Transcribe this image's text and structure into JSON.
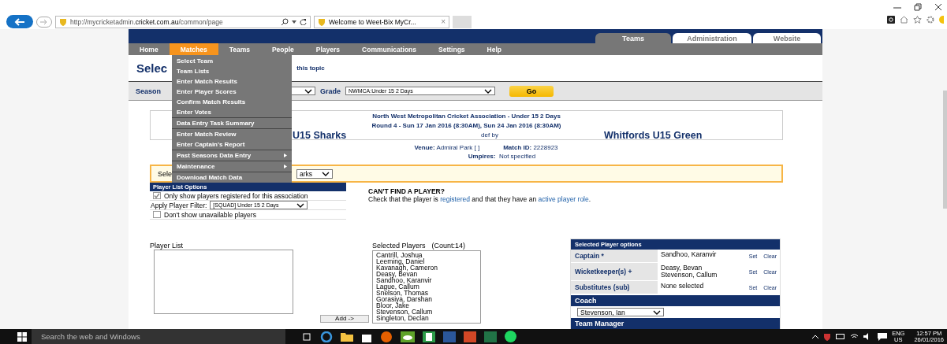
{
  "browser": {
    "address_host": "http://mycricketadmin.",
    "address_domain": "cricket.com.au",
    "address_path": "/common/page",
    "tab_title": "Welcome to Weet-Bix MyCr...",
    "tab_close": "×"
  },
  "header_tabs": [
    {
      "label": "Teams",
      "selected": true
    },
    {
      "label": "Administration",
      "selected": false
    },
    {
      "label": "Website",
      "selected": false
    }
  ],
  "nav": [
    {
      "label": "Home",
      "selected": false
    },
    {
      "label": "Matches",
      "selected": true
    },
    {
      "label": "Teams",
      "selected": false
    },
    {
      "label": "People",
      "selected": false
    },
    {
      "label": "Players",
      "selected": false
    },
    {
      "label": "Communications",
      "selected": false
    },
    {
      "label": "Settings",
      "selected": false
    },
    {
      "label": "Help",
      "selected": false
    }
  ],
  "matches_menu": [
    {
      "label": "Select Team",
      "divider": false,
      "submenu": false
    },
    {
      "label": "Team Lists",
      "divider": false,
      "submenu": false
    },
    {
      "label": "Enter Match Results",
      "divider": false,
      "submenu": false
    },
    {
      "label": "Enter Player Scores",
      "divider": false,
      "submenu": false
    },
    {
      "label": "Confirm Match Results",
      "divider": false,
      "submenu": false
    },
    {
      "label": "Enter Votes",
      "divider": false,
      "submenu": false
    },
    {
      "label": "Data Entry Task Summary",
      "divider": true,
      "submenu": false
    },
    {
      "label": "Enter Match Review",
      "divider": true,
      "submenu": false
    },
    {
      "label": "Enter Captain's Report",
      "divider": false,
      "submenu": false
    },
    {
      "label": "Past Seasons Data Entry",
      "divider": true,
      "submenu": true
    },
    {
      "label": "Maintenance",
      "divider": true,
      "submenu": true
    },
    {
      "label": "Download Match Data",
      "divider": true,
      "submenu": false
    }
  ],
  "page_title": "Selec",
  "help_link": "this topic",
  "filters": {
    "season_label": "Season",
    "grade_label": "Grade",
    "grade_value": "NWMCA:Under 15 2 Days",
    "go": "Go"
  },
  "match": {
    "association": "North West Metropolitan Cricket Association - Under 15 2 Days",
    "round": "Round 4 - Sun 17 Jan 2016 (8:30AM), Sun 24 Jan 2016 (8:30AM)",
    "home_team": "U15 Sharks",
    "result": "def by",
    "away_team": "Whitfords U15 Green",
    "venue_label": "Venue:",
    "venue": "Admiral Park [ ]",
    "match_id_label": "Match ID:",
    "match_id": "2228923",
    "umpires_label": "Umpires:",
    "umpires": "Not specified"
  },
  "team_select": {
    "label": "Sele",
    "value": "arks"
  },
  "player_list_options": {
    "title": "Player List Options",
    "options": [
      {
        "kind": "checkbox",
        "label": "Only show players registered for this association",
        "checked": true
      },
      {
        "kind": "filter",
        "label": "Apply Player Filter:",
        "value": "[SQUAD] Under 15 2 Days"
      },
      {
        "kind": "checkbox",
        "label": "Don't show unavailable players",
        "checked": false
      }
    ]
  },
  "help": {
    "title": "CAN'T FIND A PLAYER?",
    "parts": [
      {
        "kind": "text",
        "text": "Check that the player is "
      },
      {
        "kind": "link",
        "text": "registered"
      },
      {
        "kind": "text",
        "text": " and that they have an "
      },
      {
        "kind": "link",
        "text": "active player role"
      },
      {
        "kind": "text",
        "text": "."
      }
    ]
  },
  "player_list": {
    "label": "Player List",
    "add_button": "Add ->"
  },
  "selected_players": {
    "label": "Selected Players",
    "count": "(Count:14)",
    "names": [
      "Cantrill, Joshua",
      "Leeming, Daniel",
      "Kavanagh, Cameron",
      "Deasy, Bevan",
      "Sandhoo, Karanvir",
      "Lague, Callum",
      "Snelson, Thomas",
      "Gorasiya, Darshan",
      "Bloor, Jake",
      "Stevenson, Callum",
      "Singleton, Declan"
    ]
  },
  "selected_player_options": {
    "title": "Selected Player options",
    "rows": [
      {
        "label": "Captain *",
        "values": [
          "Sandhoo, Karanvir"
        ],
        "set": "Set",
        "clear": "Clear"
      },
      {
        "label": "Wicketkeeper(s)  +",
        "values": [
          "Deasy, Bevan",
          "Stevenson, Callum"
        ],
        "set": "Set",
        "clear": "Clear"
      },
      {
        "label": "Substitutes (sub)",
        "values": [
          "None selected"
        ],
        "set": "Set",
        "clear": "Clear"
      }
    ],
    "coach_title": "Coach",
    "coach": "Stevenson, Ian",
    "manager_title": "Team Manager"
  },
  "taskbar": {
    "search_placeholder": "Search the web and Windows",
    "lang": "ENG",
    "region": "US",
    "time": "12:57 PM",
    "date": "26/01/2016"
  }
}
